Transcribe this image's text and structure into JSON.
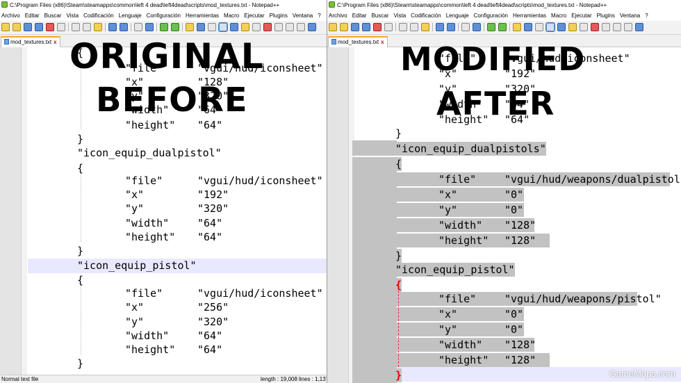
{
  "left": {
    "window_title": "C:\\Program Files (x86)\\Steam\\steamapps\\common\\left 4 dead\\left4dead\\scripts\\mod_textures.txt - Notepad++",
    "menu": [
      "Archivo",
      "Editar",
      "Buscar",
      "Vista",
      "Codificación",
      "Lenguaje",
      "Configuración",
      "Herramientas",
      "Macro",
      "Ejecutar",
      "Plugins",
      "Ventana",
      "?"
    ],
    "tab": "mod_textures.txt",
    "overlay": [
      "ORIGINAL",
      "BEFORE"
    ],
    "lines": [
      "{",
      "\t\"file\"\t\"vgui/hud/iconsheet\"",
      "\t\"x\"\t\"128\"",
      "\t\"y\"\t\"320\"",
      "\t\"width\"\t\"64\"",
      "\t\"height\"\t\"64\"",
      "}",
      "\"icon_equip_dualpistol\"",
      "{",
      "\t\"file\"\t\"vgui/hud/iconsheet\"",
      "\t\"x\"\t\"192\"",
      "\t\"y\"\t\"320\"",
      "\t\"width\"\t\"64\"",
      "\t\"height\"\t\"64\"",
      "}",
      "\"icon_equip_pistol\"",
      "{",
      "\t\"file\"\t\"vgui/hud/iconsheet\"",
      "\t\"x\"\t\"256\"",
      "\t\"y\"\t\"320\"",
      "\t\"width\"\t\"64\"",
      "\t\"height\"\t\"64\"",
      "}"
    ],
    "status": {
      "mode": "Normal text file",
      "length": "length : 19,008",
      "lines": "lines : 1,137"
    }
  },
  "right": {
    "window_title": "C:\\Program Files (x86)\\Steam\\steamapps\\common\\left 4 dead\\left4dead\\scripts\\mod_textures.txt - Notepad++",
    "menu": [
      "Archivo",
      "Editar",
      "Buscar",
      "Vista",
      "Codificación",
      "Lenguaje",
      "Configuración",
      "Herramientas",
      "Macro",
      "Ejecutar",
      "Plugins",
      "Ventana",
      "?"
    ],
    "tab": "mod_textures.txt",
    "overlay": [
      "MODIFIED",
      "AFTER"
    ],
    "lines": [
      "\t\"file\"\t\"vgui/hud/iconsheet\"",
      "\t\"x\"\t\"192\"",
      "\t\"y\"\t\"320\"",
      "\t\"width\"\t\"64\"",
      "\t\"height\"\t\"64\"",
      "}",
      "\"icon_equip_dualpistols\"",
      "{",
      "\t\"file\"\t\"vgui/hud/weapons/dualpistols\"",
      "\t\"x\"\t\"0\"",
      "\t\"y\"\t\"0\"",
      "\t\"width\"\t\"128\"",
      "\t\"height\"\t\"128\"",
      "}",
      "\"icon_equip_pistol\"",
      "{",
      "\t\"file\"\t\"vgui/hud/weapons/pistol\"",
      "\t\"x\"\t\"0\"",
      "\t\"y\"\t\"0\"",
      "\t\"width\"\t\"128\"",
      "\t\"height\"\t\"128\"",
      "}"
    ]
  },
  "watermark": "GameMaps.com"
}
